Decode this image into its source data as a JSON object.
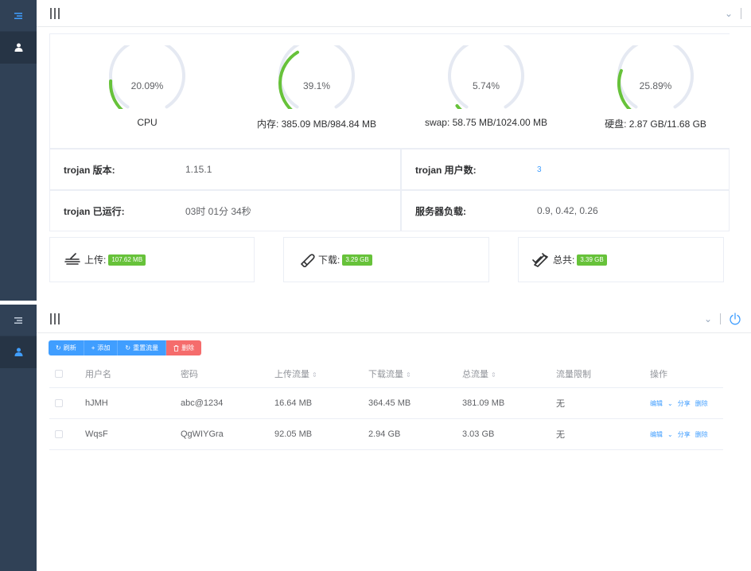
{
  "gauges": [
    {
      "pct": "20.09%",
      "value": 20.09,
      "caption": "CPU"
    },
    {
      "pct": "39.1%",
      "value": 39.1,
      "caption": "内存: 385.09 MB/984.84 MB"
    },
    {
      "pct": "5.74%",
      "value": 5.74,
      "caption": "swap: 58.75 MB/1024.00 MB"
    },
    {
      "pct": "25.89%",
      "value": 25.89,
      "caption": "硬盘: 2.87 GB/11.68 GB"
    }
  ],
  "info": {
    "version_label": "trojan 版本:",
    "version_value": "1.15.1",
    "users_label": "trojan 用户数:",
    "users_value": "3",
    "uptime_label": "trojan 已运行:",
    "uptime_value": "03时 01分 34秒",
    "load_label": "服务器负载:",
    "load_value": "0.9, 0.42, 0.26"
  },
  "traffic": {
    "upload_label": "上传:",
    "upload_value": "107.62 MB",
    "download_label": "下载:",
    "download_value": "3.29 GB",
    "total_label": "总共:",
    "total_value": "3.39 GB"
  },
  "toolbar": {
    "refresh": "刷新",
    "add": "添加",
    "reset": "重置流量",
    "delete": "删除"
  },
  "table": {
    "headers": [
      "用户名",
      "密码",
      "上传流量",
      "下载流量",
      "总流量",
      "流量限制",
      "操作"
    ],
    "rows": [
      {
        "username": "hJMH",
        "password": "abc@1234",
        "upload": "16.64 MB",
        "download": "364.45 MB",
        "total": "381.09 MB",
        "limit": "无"
      },
      {
        "username": "WqsF",
        "password": "QgWIYGra",
        "upload": "92.05 MB",
        "download": "2.94 GB",
        "total": "3.03 GB",
        "limit": "无"
      }
    ],
    "op_edit": "编辑",
    "op_share": "分享",
    "op_delete": "删除"
  },
  "colors": {
    "gauge_fill": "#67c23a",
    "gauge_track": "#e5e9f2",
    "primary": "#409eff",
    "danger": "#f56c6c",
    "sidebar": "#304156"
  },
  "icons": [
    "menu-icon",
    "user-icon",
    "hamburger-icon",
    "chevron-down-icon",
    "power-icon",
    "refresh-icon",
    "plus-icon",
    "trash-icon",
    "upload-icon",
    "download-icon",
    "total-icon"
  ]
}
